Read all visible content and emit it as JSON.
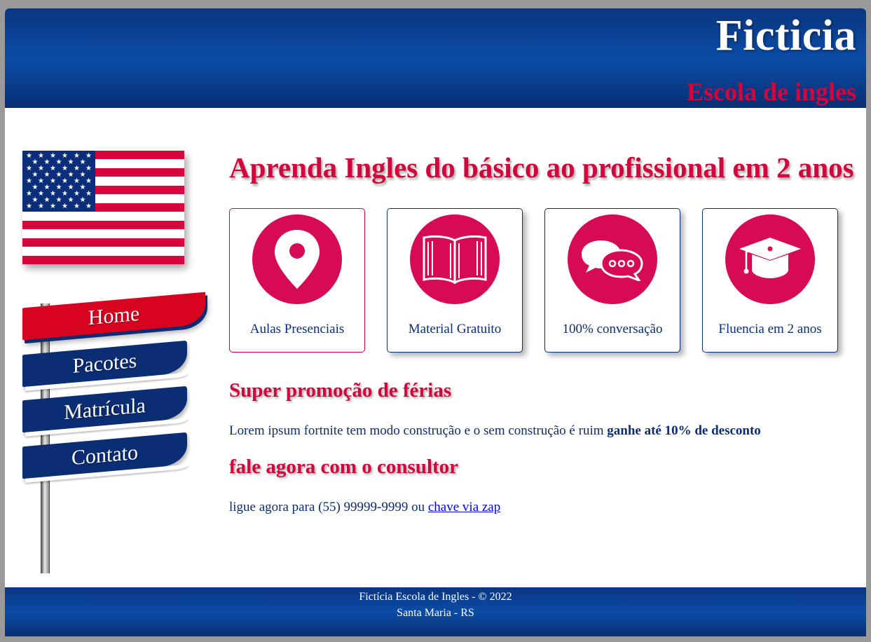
{
  "header": {
    "brand": "Ficticia",
    "subtitle": "Escola de ingles"
  },
  "sidebar": {
    "flag_icon": "us-flag",
    "nav": [
      {
        "label": "Home",
        "active": true
      },
      {
        "label": "Pacotes",
        "active": false
      },
      {
        "label": "Matrícula",
        "active": false
      },
      {
        "label": "Contato",
        "active": false
      }
    ]
  },
  "main": {
    "headline": "Aprenda Ingles do básico ao profissional em 2 anos",
    "features": [
      {
        "label": "Aulas Presenciais",
        "icon": "location-pin-icon"
      },
      {
        "label": "Material Gratuito",
        "icon": "open-book-icon"
      },
      {
        "label": "100% conversação",
        "icon": "chat-bubbles-icon"
      },
      {
        "label": "Fluencia em 2 anos",
        "icon": "graduation-cap-icon"
      }
    ],
    "promo": {
      "title": "Super promoção de férias",
      "text": "Lorem ipsum fortnite tem modo construção e o sem construção é ruim ",
      "bold": "ganhe até 10% de desconto"
    },
    "contact": {
      "title": "fale agora com o consultor",
      "text": "ligue agora para (55) 99999-9999 ou ",
      "link": "chave via zap"
    }
  },
  "footer": {
    "line1": "Fictícia Escola de Ingles - © 2022",
    "line2": "Santa Maria - RS"
  },
  "colors": {
    "brand_blue": "#0b2d73",
    "accent_red": "#d4043c",
    "icon_pink": "#d70a55"
  }
}
